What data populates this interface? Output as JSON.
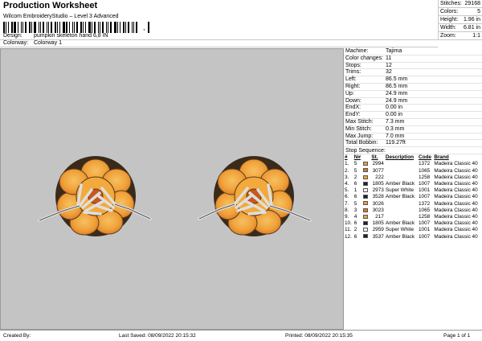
{
  "header": {
    "title": "Production Worksheet",
    "subtitle": "Wilcom EmbroideryStudio – Level 3 Advanced",
    "barcode_suffix": ",",
    "design_label": "Design:",
    "design_value": "pumpkin skeleton hand 6,8 IN",
    "colorway_label": "Colorway:",
    "colorway_value": "Colorway 1"
  },
  "stats": [
    {
      "label": "Stitches:",
      "value": "29168"
    },
    {
      "label": "Colors:",
      "value": "5"
    },
    {
      "label": "Height:",
      "value": "1.96 in"
    },
    {
      "label": "Width:",
      "value": "6.81 in"
    },
    {
      "label": "Zoom:",
      "value": "1:1"
    }
  ],
  "machine_info": [
    {
      "label": "Machine:",
      "value": "Tajima"
    },
    {
      "label": "Color changes:",
      "value": "11"
    },
    {
      "label": "Stops:",
      "value": "12"
    },
    {
      "label": "Trims:",
      "value": "32"
    },
    {
      "label": "Left:",
      "value": "86.5 mm"
    },
    {
      "label": "Right:",
      "value": "86.5 mm"
    },
    {
      "label": "Up:",
      "value": "24.9 mm"
    },
    {
      "label": "Down:",
      "value": "24.9 mm"
    },
    {
      "label": "EndX:",
      "value": "0.00 in"
    },
    {
      "label": "EndY:",
      "value": "0.00 in"
    },
    {
      "label": "Max Stitch:",
      "value": "7.3 mm"
    },
    {
      "label": "Min Stitch:",
      "value": "0.3 mm"
    },
    {
      "label": "Max Jump:",
      "value": "7.0 mm"
    },
    {
      "label": "Total Bobbin:",
      "value": "119.27ft"
    }
  ],
  "stop_sequence": {
    "title": "Stop Sequence:",
    "headers": [
      "#",
      "N#",
      "",
      "St.",
      "Description",
      "Code",
      "Brand"
    ],
    "rows": [
      {
        "n": "1.",
        "nn": "5",
        "color": "#e8a040",
        "st": "2994",
        "desc": "",
        "code": "1372",
        "brand": "Madeira Classic 40"
      },
      {
        "n": "2.",
        "nn": "5",
        "color": "#d8782a",
        "st": "3077",
        "desc": "",
        "code": "1065",
        "brand": "Madeira Classic 40"
      },
      {
        "n": "3.",
        "nn": "2",
        "color": "#f2a63a",
        "st": "222",
        "desc": "",
        "code": "1258",
        "brand": "Madeira Classic 40"
      },
      {
        "n": "4.",
        "nn": "6",
        "color": "#222222",
        "st": "1805",
        "desc": "Amber Black",
        "code": "1007",
        "brand": "Madeira Classic 40"
      },
      {
        "n": "5.",
        "nn": "1",
        "color": "#f4f4f4",
        "st": "2973",
        "desc": "Super White",
        "code": "1001",
        "brand": "Madeira Classic 40"
      },
      {
        "n": "6.",
        "nn": "6",
        "color": "#222222",
        "st": "3528",
        "desc": "Amber Black",
        "code": "1007",
        "brand": "Madeira Classic 40"
      },
      {
        "n": "7.",
        "nn": "5",
        "color": "#e8a040",
        "st": "3026",
        "desc": "",
        "code": "1372",
        "brand": "Madeira Classic 40"
      },
      {
        "n": "8.",
        "nn": "3",
        "color": "#d8782a",
        "st": "3023",
        "desc": "",
        "code": "1065",
        "brand": "Madeira Classic 40"
      },
      {
        "n": "9.",
        "nn": "4",
        "color": "#f2a63a",
        "st": "217",
        "desc": "",
        "code": "1258",
        "brand": "Madeira Classic 40"
      },
      {
        "n": "10.",
        "nn": "6",
        "color": "#222222",
        "st": "1805",
        "desc": "Amber Black",
        "code": "1007",
        "brand": "Madeira Classic 40"
      },
      {
        "n": "11.",
        "nn": "2",
        "color": "#f4f4f4",
        "st": "2959",
        "desc": "Super White",
        "code": "1001",
        "brand": "Madeira Classic 40"
      },
      {
        "n": "12.",
        "nn": "6",
        "color": "#222222",
        "st": "3537",
        "desc": "Amber Black",
        "code": "1007",
        "brand": "Madeira Classic 40"
      }
    ]
  },
  "footer": {
    "created_by": "Created By:",
    "last_saved": "Last Saved: 08/09/2022 20:15:32",
    "printed": "Printed: 08/09/2022 20:15:35",
    "page": "Page 1 of 1"
  },
  "colors": {
    "canvas_bg": "#c4c4c4",
    "pumpkin_light": "#f3a93b",
    "pumpkin_dark": "#d8782a",
    "outline": "#3a2a1a",
    "bone": "#dedede"
  }
}
